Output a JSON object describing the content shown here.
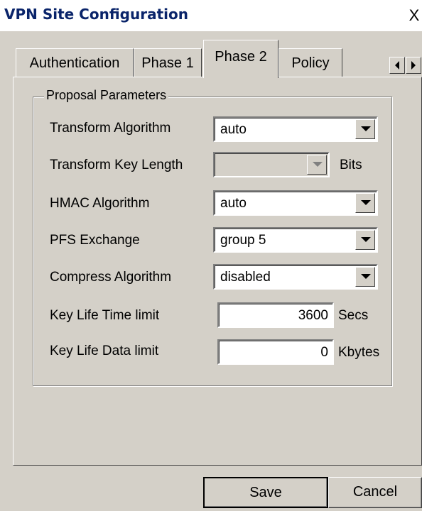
{
  "window": {
    "title": "VPN Site Configuration",
    "close_label": "X"
  },
  "tabs": [
    {
      "label": "Authentication"
    },
    {
      "label": "Phase 1"
    },
    {
      "label": "Phase 2",
      "selected": true
    },
    {
      "label": "Policy"
    }
  ],
  "group": {
    "title": "Proposal Parameters"
  },
  "fields": {
    "transform_algorithm": {
      "label": "Transform Algorithm",
      "value": "auto"
    },
    "transform_key_length": {
      "label": "Transform Key Length",
      "value": "",
      "unit": "Bits",
      "disabled": true
    },
    "hmac_algorithm": {
      "label": "HMAC Algorithm",
      "value": "auto"
    },
    "pfs_exchange": {
      "label": "PFS Exchange",
      "value": "group 5"
    },
    "compress_algorithm": {
      "label": "Compress Algorithm",
      "value": "disabled"
    },
    "key_life_time": {
      "label": "Key Life Time limit",
      "value": "3600",
      "unit": "Secs"
    },
    "key_life_data": {
      "label": "Key Life Data limit",
      "value": "0",
      "unit": "Kbytes"
    }
  },
  "buttons": {
    "save": "Save",
    "cancel": "Cancel"
  },
  "icons": {
    "close": "close-icon",
    "tab_left": "arrow-left-icon",
    "tab_right": "arrow-right-icon",
    "dropdown": "chevron-down-icon"
  }
}
